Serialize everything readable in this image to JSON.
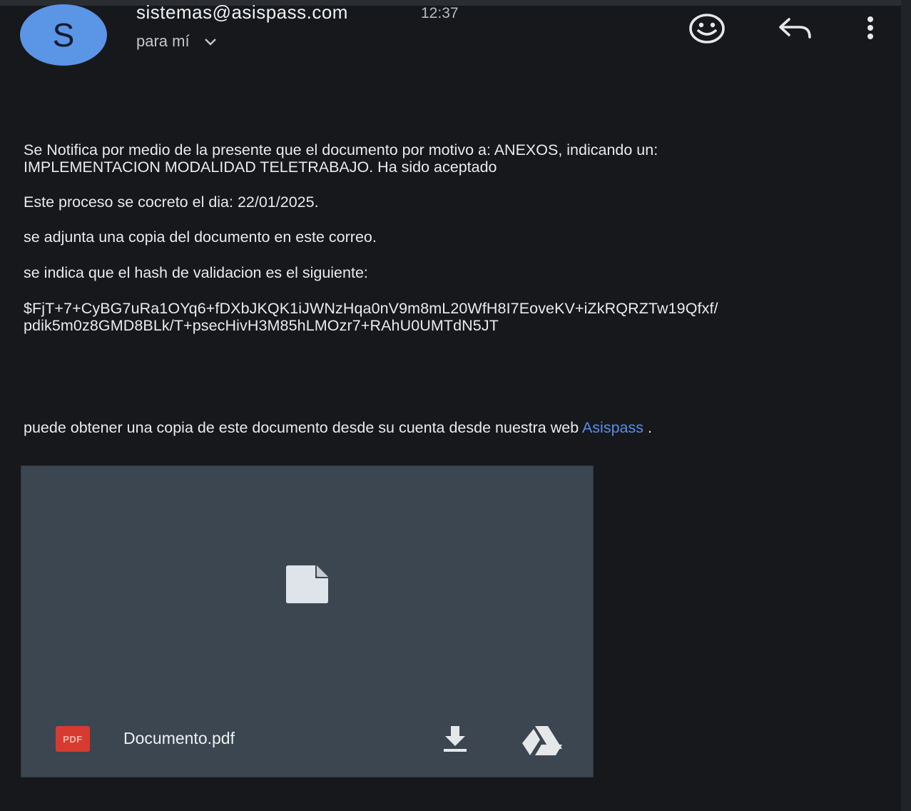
{
  "header": {
    "avatar_letter": "S",
    "sender": "sistemas@asispass.com",
    "time": "12:37",
    "recipient": "para mí",
    "icons": [
      "smiley-icon",
      "reply-icon",
      "more-vert-icon"
    ]
  },
  "body": {
    "paragraph1_line1": "Se Notifica por medio de la presente que el documento por motivo a: ANEXOS, indicando un:",
    "paragraph1_line2": "IMPLEMENTACION MODALIDAD TELETRABAJO. Ha sido aceptado",
    "paragraph2": "Este proceso se cocreto el dia: 22/01/2025.",
    "paragraph3": "se adjunta una copia del documento en este correo.",
    "paragraph4": "se indica que el hash de validacion es el siguiente:",
    "hash_line1": "$FjT+7+CyBG7uRa1OYq6+fDXbJKQK1iJWNzHqa0nV9m8mL20WfH8I7EoveKV+iZkRQRZTw19Qfxf/",
    "hash_line2": "pdik5m0z8GMD8BLk/T+psecHivH3M85hLMOzr7+RAhU0UMTdN5JT",
    "paragraph5_prefix": "puede obtener una copia de este documento desde su cuenta desde nuestra web ",
    "link_text": "Asispass",
    "paragraph5_suffix": " ."
  },
  "attachment": {
    "type_badge": "PDF",
    "filename": "Documento.pdf",
    "icons": [
      "file-icon",
      "download-icon",
      "drive-icon"
    ]
  },
  "colors": {
    "background": "#16181b",
    "avatar": "#5a95e6",
    "link": "#5b8df0",
    "attachment_card": "#3c4650",
    "pdf_badge": "#d93a2f"
  }
}
